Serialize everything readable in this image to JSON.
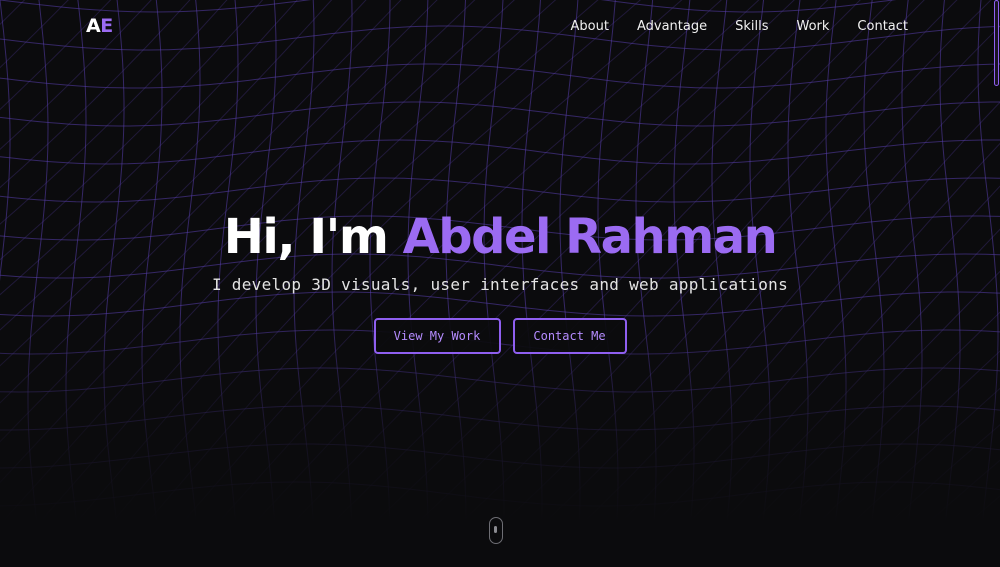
{
  "header": {
    "logo": {
      "part1": "A",
      "part2": "E"
    },
    "nav": [
      {
        "label": "About"
      },
      {
        "label": "Advantage"
      },
      {
        "label": "Skills"
      },
      {
        "label": "Work"
      },
      {
        "label": "Contact"
      }
    ]
  },
  "hero": {
    "greeting": "Hi, I'm ",
    "name": "Abdel Rahman",
    "subtitle": "I develop 3D visuals, user interfaces and web applications",
    "buttons": {
      "view_work": "View My Work",
      "contact": "Contact Me"
    }
  },
  "colors": {
    "accent": "#9b6bf2",
    "background": "#0b0b0d",
    "grid_line": "#5a3fae"
  },
  "icons": {
    "scroll": "mouse-scroll-icon"
  }
}
